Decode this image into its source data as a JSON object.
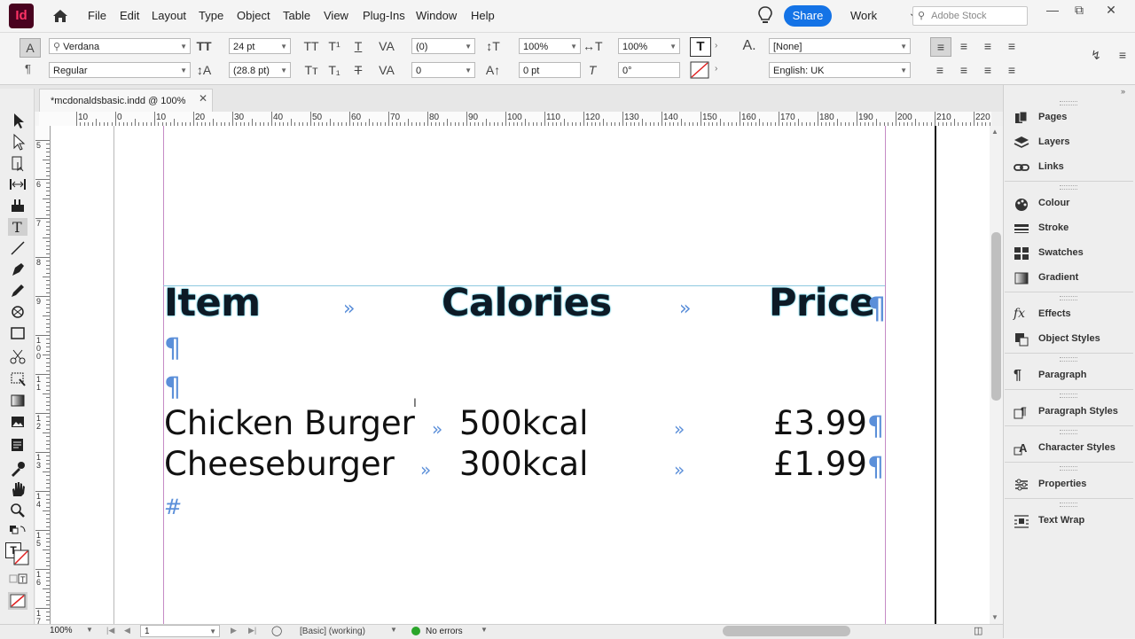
{
  "app": {
    "logo": "Id"
  },
  "menu": [
    "File",
    "Edit",
    "Layout",
    "Type",
    "Object",
    "Table",
    "View",
    "Plug-Ins",
    "Window",
    "Help"
  ],
  "share": "Share",
  "workspace": "Work",
  "stock_search": "Adobe Stock",
  "control": {
    "font_family": "Verdana",
    "font_style": "Regular",
    "font_size": "24 pt",
    "leading": "(28.8 pt)",
    "kerning": "(0)",
    "tracking": "0",
    "vscale": "100%",
    "hscale": "100%",
    "baseline": "0 pt",
    "skew": "0°",
    "char_style": "[None]",
    "language": "English: UK"
  },
  "document_tab": "*mcdonaldsbasic.indd @ 100%",
  "ruler_h": [
    "10",
    "0",
    "10",
    "20",
    "30",
    "40",
    "50",
    "60",
    "70",
    "80",
    "90",
    "100",
    "110",
    "120",
    "130",
    "140",
    "150",
    "160",
    "170",
    "180",
    "190",
    "200",
    "210",
    "220"
  ],
  "ruler_v": [
    "5",
    "6",
    "7",
    "8",
    "9",
    "1\n0\n0",
    "1\n1",
    "1\n2",
    "1\n3",
    "1\n4",
    "1\n5",
    "1\n6",
    "1\n7"
  ],
  "page_text": {
    "header": [
      "Item",
      "Calories",
      "Price"
    ],
    "rows": [
      [
        "Chicken Burger",
        "500kcal",
        "£3.99"
      ],
      [
        "Cheeseburger",
        "300kcal",
        "£1.99"
      ]
    ],
    "hidden_chars": {
      "tab": "»",
      "pilcrow": "¶",
      "end": "#"
    }
  },
  "panels": [
    "Pages",
    "Layers",
    "Links",
    "Colour",
    "Stroke",
    "Swatches",
    "Gradient",
    "Effects",
    "Object Styles",
    "Paragraph",
    "Paragraph Styles",
    "Character Styles",
    "Properties",
    "Text Wrap"
  ],
  "status": {
    "zoom": "100%",
    "page": "1",
    "profile": "[Basic] (working)",
    "preflight": "No errors",
    "preflight_color": "#2aa52a"
  }
}
